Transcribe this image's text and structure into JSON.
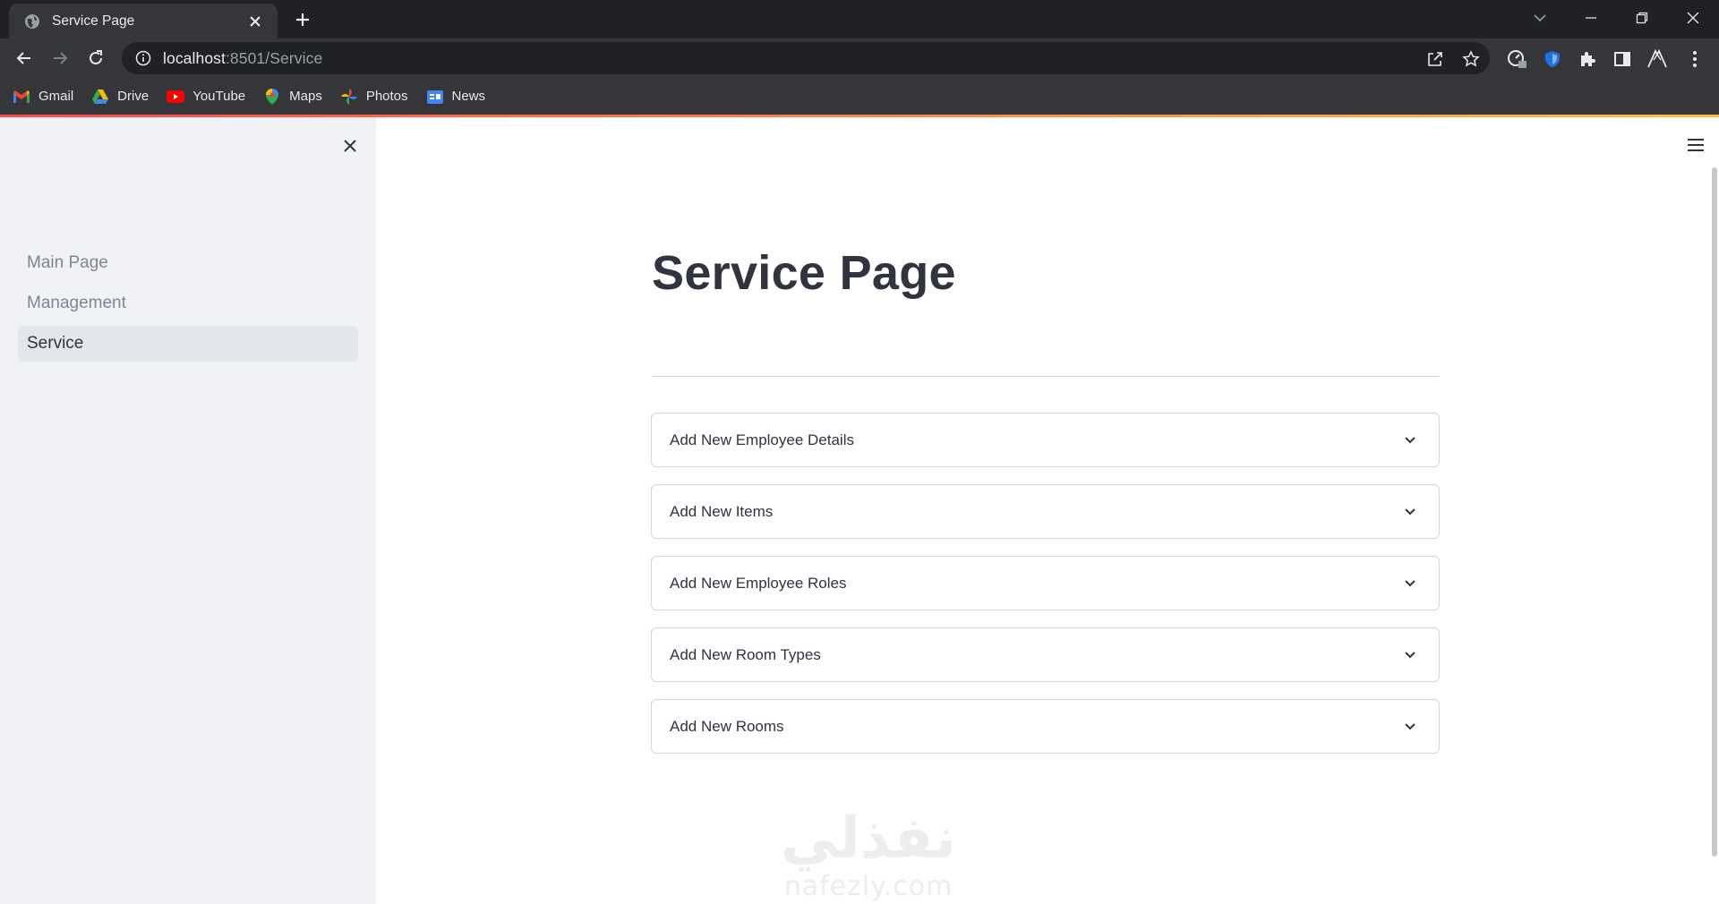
{
  "browser": {
    "tab_title": "Service Page",
    "url_host": "localhost",
    "url_rest": ":8501/Service",
    "bookmarks": [
      {
        "label": "Gmail",
        "icon": "gmail-icon"
      },
      {
        "label": "Drive",
        "icon": "drive-icon"
      },
      {
        "label": "YouTube",
        "icon": "youtube-icon"
      },
      {
        "label": "Maps",
        "icon": "maps-icon"
      },
      {
        "label": "Photos",
        "icon": "photos-icon"
      },
      {
        "label": "News",
        "icon": "news-icon"
      }
    ]
  },
  "sidebar": {
    "items": [
      {
        "label": "Main Page",
        "active": false
      },
      {
        "label": "Management",
        "active": false
      },
      {
        "label": "Service",
        "active": true
      }
    ]
  },
  "main": {
    "title": "Service Page",
    "expanders": [
      {
        "label": "Add New Employee Details"
      },
      {
        "label": "Add New Items"
      },
      {
        "label": "Add New Employee Roles"
      },
      {
        "label": "Add New Room Types"
      },
      {
        "label": "Add New Rooms"
      }
    ]
  },
  "watermark": {
    "arabic": "نفذلي",
    "latin": "nafezly.com"
  },
  "colors": {
    "accent_start": "#ff4b4b",
    "accent_end": "#ffbd45",
    "text": "#31333f",
    "sidebar_bg": "#f0f2f6"
  }
}
